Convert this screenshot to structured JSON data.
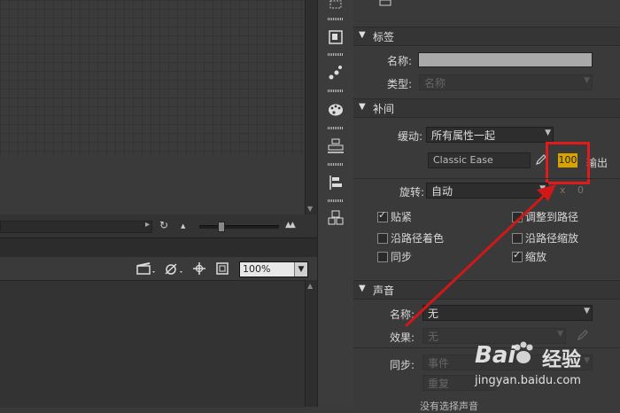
{
  "stage": {
    "zoom_value": "100%",
    "hscroll_arrow": "▸",
    "rotate_icon": "↻",
    "mountain_small": "▲",
    "mountain_large": "▲▲"
  },
  "tools": {
    "strip_icons": [
      "select-icon",
      "library-icon",
      "motion-icon",
      "palette-icon",
      "align-icon",
      "distribute-icon",
      "transform-icon"
    ]
  },
  "properties": {
    "label_section": {
      "title": "标签",
      "name_label": "名称:",
      "type_label": "类型:",
      "type_value": "名称"
    },
    "tween_section": {
      "title": "补间",
      "ease_label": "缓动:",
      "ease_value": "所有属性一起",
      "ease_preset": "Classic Ease",
      "ease_amount": "100",
      "output_label": "输出",
      "rotate_label": "旋转:",
      "rotate_value": "自动",
      "rotate_x": "x",
      "rotate_count": "0",
      "options": [
        {
          "label": "贴紧",
          "checked": true
        },
        {
          "label": "调整到路径",
          "checked": false
        },
        {
          "label": "沿路径着色",
          "checked": false
        },
        {
          "label": "沿路径缩放",
          "checked": false
        },
        {
          "label": "同步",
          "checked": false
        },
        {
          "label": "缩放",
          "checked": true
        }
      ]
    },
    "sound_section": {
      "title": "声音",
      "name_label": "名称:",
      "name_value": "无",
      "effect_label": "效果:",
      "effect_value": "无",
      "sync_label": "同步:",
      "sync_value": "事件",
      "repeat_value": "重复",
      "note": "没有选择声音"
    }
  },
  "watermark": {
    "brand": "Bai",
    "brand2": "经验",
    "url": "jingyan.baidu.com"
  },
  "colors": {
    "highlight_box": "#e01b1b",
    "value_bg": "#d9a400",
    "arrow": "#d01818"
  }
}
